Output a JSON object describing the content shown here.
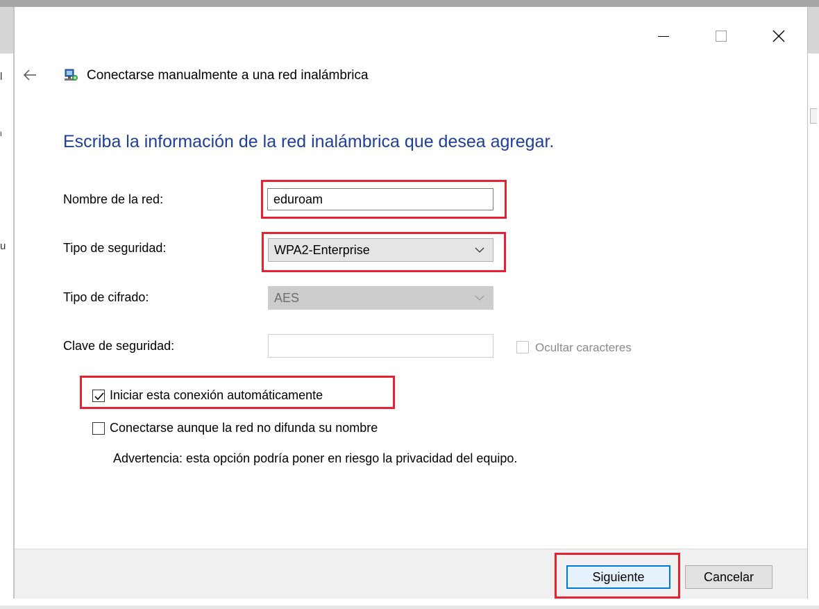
{
  "window": {
    "title": "Conectarse manualmente a una red inalámbrica"
  },
  "heading": "Escriba la información de la red inalámbrica que desea agregar.",
  "form": {
    "network_name": {
      "label": "Nombre de la red:",
      "value": "eduroam"
    },
    "security_type": {
      "label": "Tipo de seguridad:",
      "value": "WPA2-Enterprise"
    },
    "encryption_type": {
      "label": "Tipo de cifrado:",
      "value": "AES"
    },
    "security_key": {
      "label": "Clave de seguridad:",
      "value": ""
    },
    "hide_characters": {
      "label": "Ocultar caracteres",
      "checked": false
    },
    "auto_connect": {
      "label": "Iniciar esta conexión automáticamente",
      "checked": true
    },
    "connect_hidden": {
      "label": "Conectarse aunque la red no difunda su nombre",
      "checked": false
    },
    "warning": "Advertencia: esta opción podría poner en riesgo la privacidad del equipo."
  },
  "buttons": {
    "next": "Siguiente",
    "cancel": "Cancelar"
  },
  "colors": {
    "heading": "#1e3f9a",
    "highlight": "#e8202f",
    "primary_border": "#0078d7"
  },
  "background_fragments": {
    "a": "l",
    "b": "ι",
    "c": "u"
  }
}
